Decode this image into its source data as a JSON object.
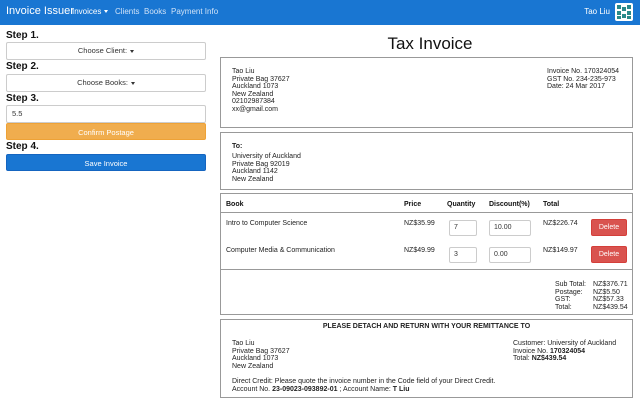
{
  "navbar": {
    "brand": "Invoice Issuer",
    "items": [
      "Invoices",
      "Clients",
      "Books",
      "Payment Info"
    ],
    "user": "Tao Liu",
    "color": "#1976d2"
  },
  "steps": {
    "step1": "Step 1.",
    "step2": "Step 2.",
    "step3": "Step 3.",
    "step4": "Step 4.",
    "choose_client": "Choose Client:",
    "choose_books": "Choose Books:",
    "postage_value": "5.5",
    "confirm_postage": "Confirm Postage",
    "save_invoice": "Save Invoice"
  },
  "invoice": {
    "title": "Tax Invoice",
    "sender_lines": [
      "Tao Liu",
      "Private Bag 37627",
      "Auckland 1073",
      "New Zealand",
      "02102987384",
      "xx@gmail.com"
    ],
    "meta_lines": [
      "Invoice No. 170324054",
      "GST No. 234-235-973",
      "Date: 24 Mar 2017"
    ],
    "to_label": "To:",
    "to_lines": [
      "University of Auckland",
      "Private Bag 92019",
      "Auckland 1142",
      "New Zealand"
    ],
    "headers": {
      "book": "Book",
      "price": "Price",
      "quantity": "Quantity",
      "discount": "Discount(%)",
      "total": "Total"
    },
    "rows": [
      {
        "book": "Intro to Computer Science",
        "price": "NZ$35.99",
        "quantity": "7",
        "discount": "10.00",
        "total": "NZ$226.74",
        "action": "Delete"
      },
      {
        "book": "Computer Media & Communication",
        "price": "NZ$49.99",
        "quantity": "3",
        "discount": "0.00",
        "total": "NZ$149.97",
        "action": "Delete"
      }
    ],
    "summary": [
      {
        "label": "Sub Total:",
        "value": "NZ$376.71"
      },
      {
        "label": "Postage:",
        "value": "NZ$5.50"
      },
      {
        "label": "GST:",
        "value": "NZ$57.33"
      },
      {
        "label": "Total:",
        "value": "NZ$439.54"
      }
    ]
  },
  "remittance": {
    "heading": "PLEASE DETACH AND RETURN WITH YOUR REMITTANCE TO",
    "address_lines": [
      "Tao Liu",
      "Private Bag 37627",
      "Auckland 1073",
      "New Zealand"
    ],
    "customer_label": "Customer:",
    "customer_value": "University of Auckland",
    "invoice_label": "Invoice No.",
    "invoice_value": "170324054",
    "total_label": "Total:",
    "total_value": "NZ$439.54",
    "direct_credit": "Direct Credit: Please quote the invoice number in the Code field of your Direct Credit.",
    "account_label": "Account No.",
    "account_value": "23-09023-093892-01",
    "account_name_label": "; Account Name:",
    "account_name_value": "T Liu"
  }
}
